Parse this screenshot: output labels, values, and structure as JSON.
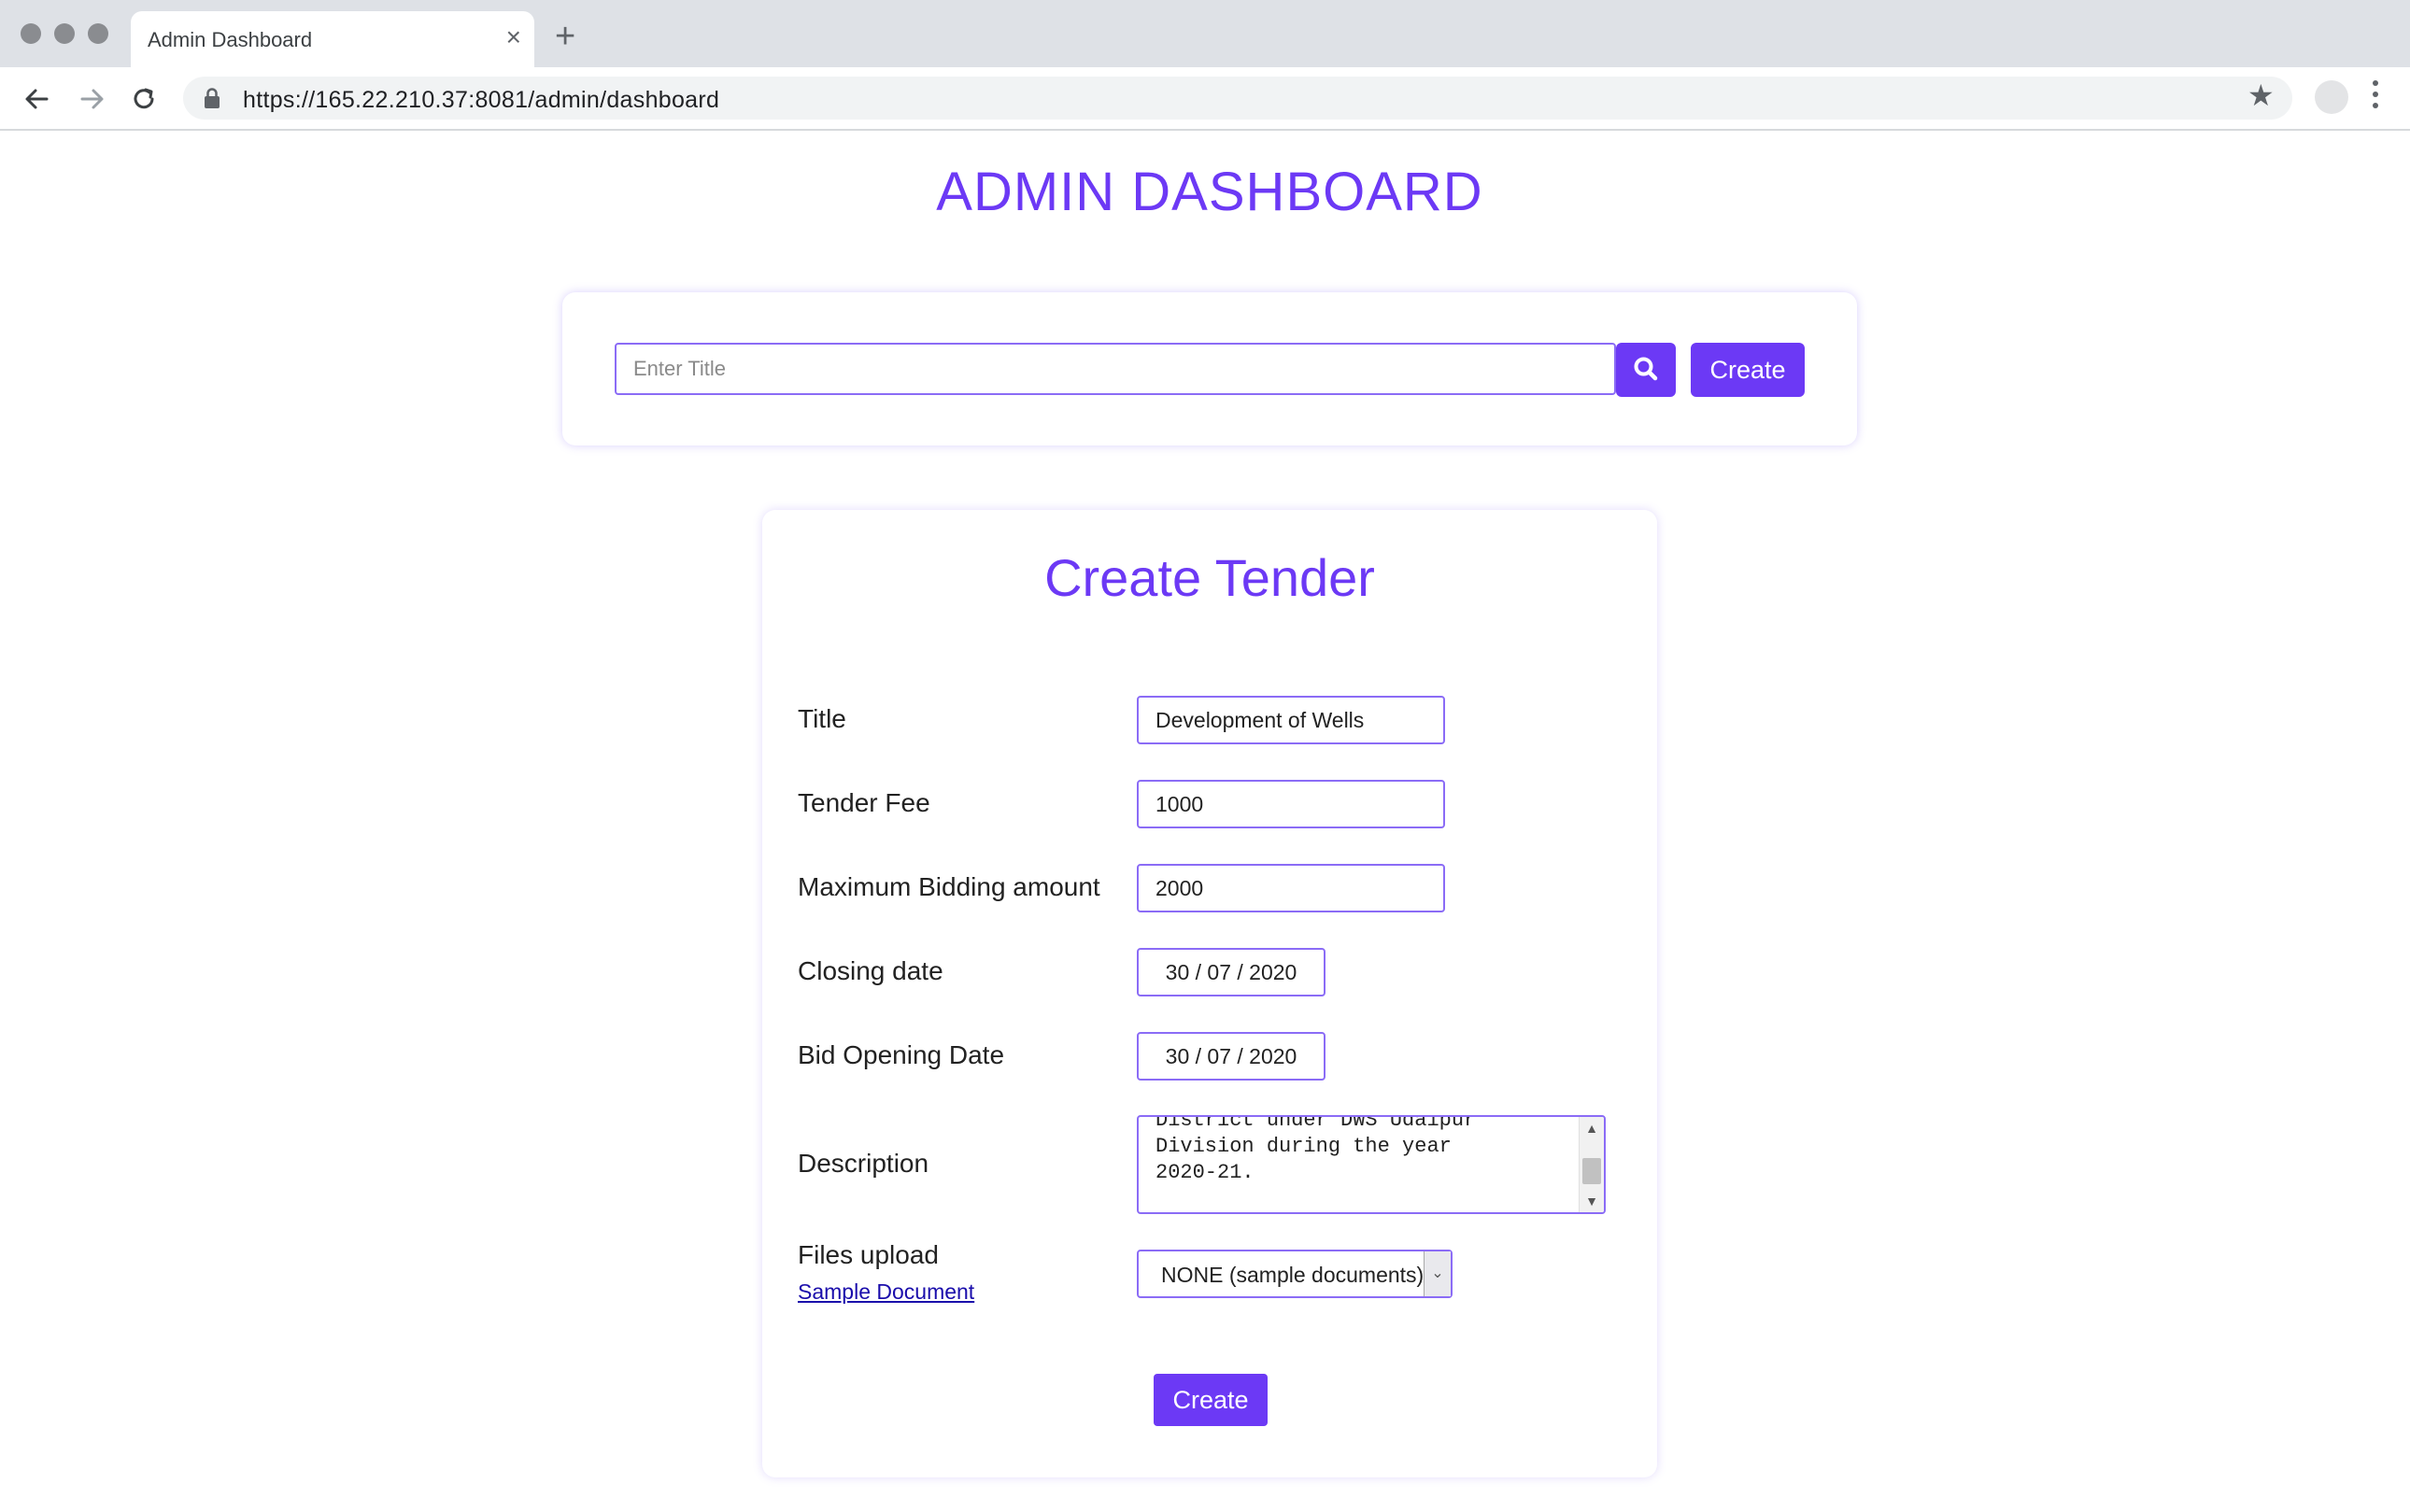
{
  "browser": {
    "tab_title": "Admin Dashboard",
    "tab_close": "×",
    "new_tab": "+",
    "url": "https://165.22.210.37:8081/admin/dashboard",
    "star": "★"
  },
  "page": {
    "title": "ADMIN DASHBOARD"
  },
  "search": {
    "placeholder": "Enter Title",
    "create_label": "Create"
  },
  "form": {
    "title": "Create Tender",
    "fields": {
      "title": {
        "label": "Title",
        "value": "Development of Wells"
      },
      "tender_fee": {
        "label": "Tender Fee",
        "value": "1000"
      },
      "max_bid": {
        "label": "Maximum Bidding amount",
        "value": "2000"
      },
      "closing_date": {
        "label": "Closing date",
        "value": "30 / 07 / 2020"
      },
      "bid_opening_date": {
        "label": "Bid Opening Date",
        "value": "30 / 07 / 2020"
      },
      "description": {
        "label": "Description",
        "value": "District under DWS Udaipur\nDivision during the year\n2020-21."
      },
      "files_upload": {
        "label": "Files upload",
        "link": "Sample Document",
        "selected": "NONE (sample documents)"
      }
    },
    "create_label": "Create"
  }
}
